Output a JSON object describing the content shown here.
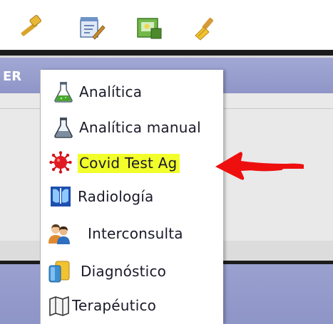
{
  "toolbar": {
    "buttons": [
      {
        "icon": "hammer-icon"
      },
      {
        "icon": "edit-document-icon"
      },
      {
        "icon": "green-document-icon"
      },
      {
        "icon": "brush-icon"
      }
    ]
  },
  "header": {
    "text": "ER"
  },
  "menu": {
    "items": [
      {
        "label": "Analítica",
        "icon": "flask-blue-icon"
      },
      {
        "label": "Analítica manual",
        "icon": "flask-dark-icon"
      },
      {
        "label": "Covid Test Ag",
        "icon": "virus-icon",
        "highlighted": true,
        "highlight_color": "#f2ff2a"
      },
      {
        "label": "Radiología",
        "icon": "xray-icon"
      },
      {
        "label": "Interconsulta",
        "icon": "people-icon"
      },
      {
        "label": "Diagnóstico",
        "icon": "folder-icon"
      },
      {
        "label": "Terapéutico",
        "icon": "map-book-icon"
      }
    ]
  },
  "annotation": {
    "icon": "red-arrow-icon",
    "color": "#ee0f0f"
  },
  "colors": {
    "header": "#949bcb",
    "toolbar_bg": "#ffffff",
    "menu_bg": "#ffffff",
    "highlight": "#f2ff2a",
    "arrow": "#ee0f0f"
  }
}
